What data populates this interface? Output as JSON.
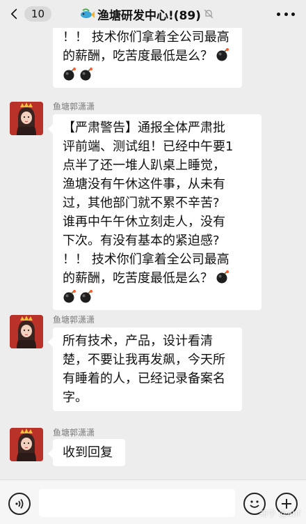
{
  "header": {
    "unread_count": "10",
    "title": "渔塘研发中心!(89)"
  },
  "messages": [
    {
      "partial": true,
      "lines": [
        "！！ 技术你们拿着全公司最高",
        "的薪酬，吃苦度最低是么？"
      ],
      "bomb_count": 3
    },
    {
      "sender": "鱼塘郭潇潇",
      "lines": [
        "【严肃警告】通报全体严肃批",
        "评前端、测试组！已经中午要1",
        "点半了还一堆人趴桌上睡觉，",
        "渔塘没有午休这件事，从未有",
        "过，其他部门就不累不辛苦?",
        "谁再中午午休立刻走人，没有",
        "下次。有没有基本的紧迫感?",
        "！！ 技术你们拿着全公司最高",
        "的薪酬，吃苦度最低是么？"
      ],
      "bomb_count": 3
    },
    {
      "sender": "鱼塘郭潇潇",
      "lines": [
        "所有技术，产品，设计看清",
        "楚，不要让我再发飙，今天所",
        "有睡着的人，已经记录备案名",
        "字。"
      ]
    },
    {
      "sender": "鱼塘郭潇潇",
      "lines": [
        "收到回复"
      ]
    }
  ],
  "watermark": "知乎 @abf",
  "icons": {
    "back": "chevron-left-icon",
    "group": "fish-icon",
    "mute": "mute-bell-icon",
    "more": "more-dots-icon",
    "bomb": "bomb-emoji-icon",
    "voice": "voice-icon",
    "emoji": "emoji-icon",
    "plus": "plus-icon"
  }
}
